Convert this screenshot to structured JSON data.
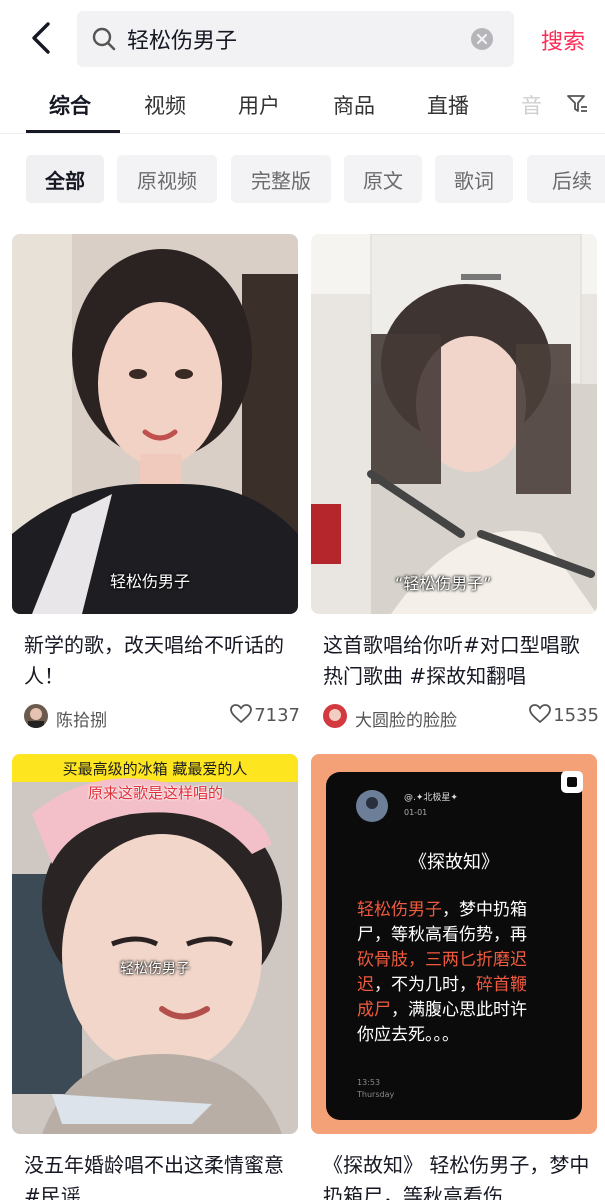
{
  "search": {
    "query": "轻松伤男子",
    "button_label": "搜索"
  },
  "tabs": [
    {
      "label": "综合",
      "active": true
    },
    {
      "label": "视频"
    },
    {
      "label": "用户"
    },
    {
      "label": "商品"
    },
    {
      "label": "直播"
    },
    {
      "label": "音"
    }
  ],
  "chips": [
    {
      "label": "全部",
      "active": true
    },
    {
      "label": "原视频"
    },
    {
      "label": "完整版"
    },
    {
      "label": "原文"
    },
    {
      "label": "歌词"
    },
    {
      "label": "后续"
    }
  ],
  "cards": [
    {
      "title": "新学的歌，改天唱给不听话的人！",
      "author": "陈拾捌",
      "likes": "7137",
      "overlay": "轻松伤男子"
    },
    {
      "title": "这首歌唱给你听#对口型唱歌热门歌曲 #探故知翻唱",
      "author": "大圆脸的脸脸",
      "likes": "1535",
      "overlay": "“轻松伤男子”"
    },
    {
      "title": "没五年婚龄唱不出这柔情蜜意#民谣",
      "banner_top": "买最高级的冰箱 藏最爱的人",
      "banner_sub": "原来这歌是这样唱的",
      "overlay": "轻松伤男子"
    },
    {
      "title": "《探故知》 轻松伤男子，梦中扔箱尸，等秋高看伤",
      "post_user": "@.✦北极星✦",
      "post_date": "01-01",
      "post_heading": "《探故知》",
      "post_line1a": "轻松伤男子",
      "post_line1b": "，梦中扔箱",
      "post_line2": "尸，等秋高看伤势，再",
      "post_line3a": "砍骨肢，三两匕折磨迟",
      "post_line4a": "迟",
      "post_line4b": "，不为几时，",
      "post_line4c": "碎首鞭",
      "post_line5a": "成尸",
      "post_line5b": "，满腹心思此时许",
      "post_line6": "你应去死。。。",
      "post_time": "13:53",
      "post_day": "Thursday"
    }
  ],
  "colors": {
    "accent": "#fe2c55",
    "post_red": "#f05a3f",
    "post_card_bg": "#f4a178"
  }
}
